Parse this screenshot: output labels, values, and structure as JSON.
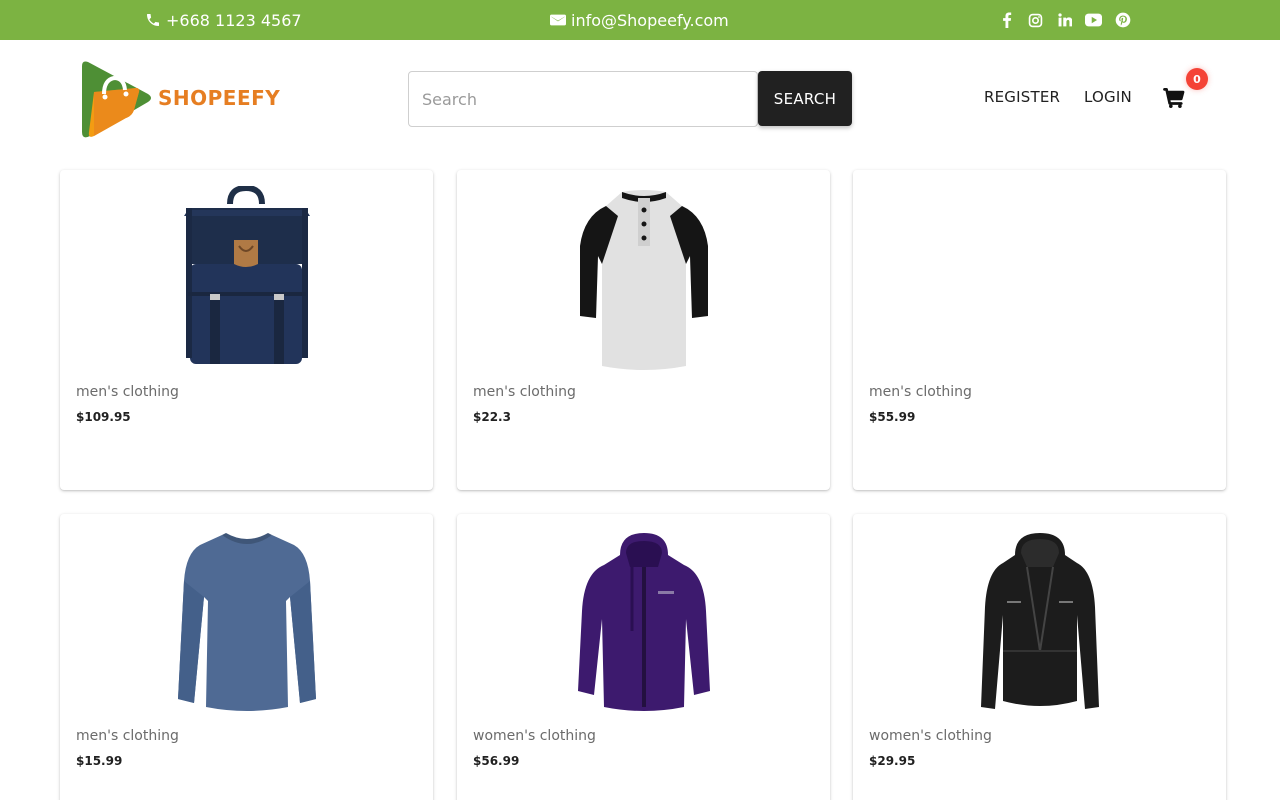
{
  "topbar": {
    "phone": "+668 1123 4567",
    "email": "info@Shopeefy.com",
    "socials": [
      "facebook-icon",
      "instagram-icon",
      "linkedin-icon",
      "youtube-icon",
      "pinterest-icon"
    ],
    "bg_color": "#7cb342"
  },
  "header": {
    "logo_text": "SHOPEEFY",
    "search_placeholder": "Search",
    "search_value": "",
    "search_button": "SEARCH",
    "register": "REGISTER",
    "login": "LOGIN",
    "cart_count": "0"
  },
  "products": [
    {
      "category": "men's clothing",
      "price": "$109.95",
      "image": "backpack"
    },
    {
      "category": "men's clothing",
      "price": "$22.3",
      "image": "raglan-tshirt"
    },
    {
      "category": "men's clothing",
      "price": "$55.99",
      "image": "none"
    },
    {
      "category": "men's clothing",
      "price": "$15.99",
      "image": "long-sleeve-shirt"
    },
    {
      "category": "women's clothing",
      "price": "$56.99",
      "image": "purple-jacket"
    },
    {
      "category": "women's clothing",
      "price": "$29.95",
      "image": "leather-jacket"
    }
  ],
  "colors": {
    "accent_green": "#7cb342",
    "logo_orange": "#e67e22",
    "badge_red": "#f44336",
    "button_dark": "#212121"
  }
}
